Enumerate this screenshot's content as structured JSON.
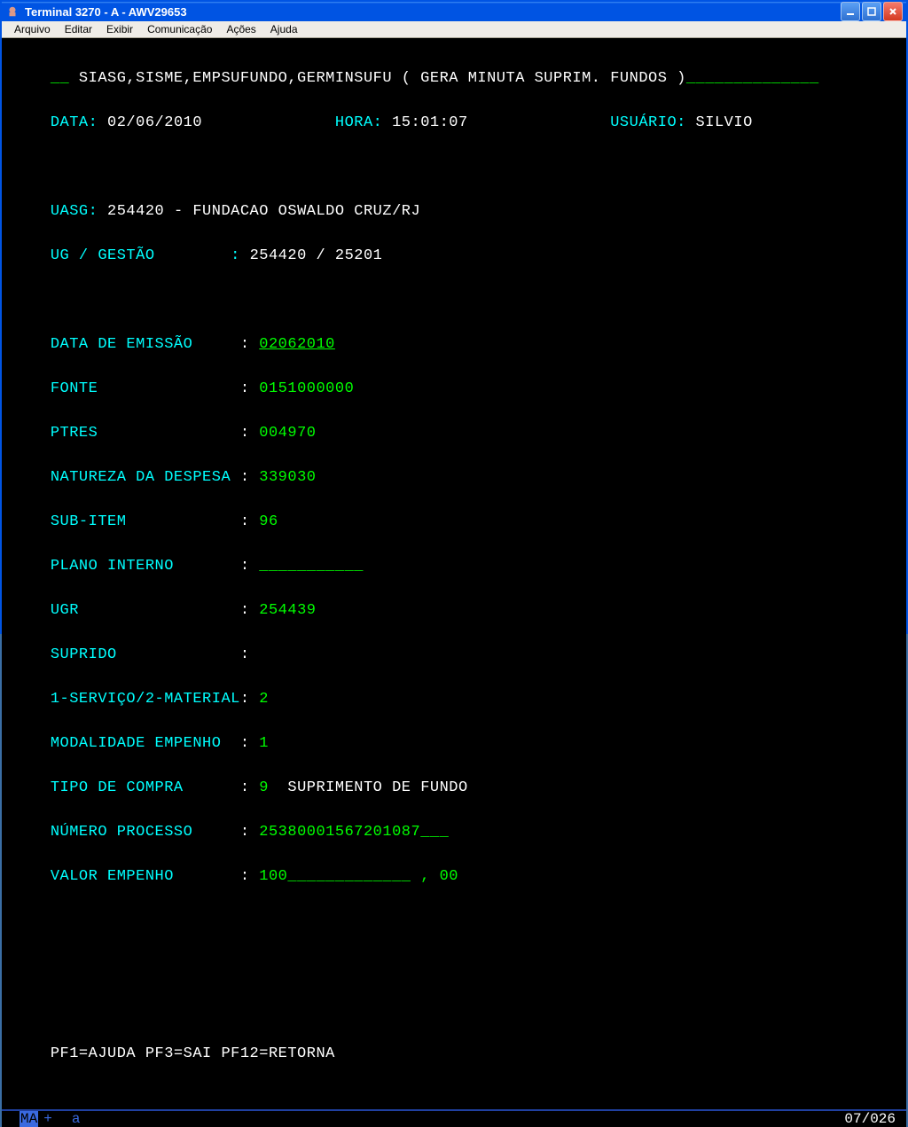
{
  "titlebar": {
    "text": "Terminal 3270 - A - AWV29653"
  },
  "menubar": {
    "arquivo": "Arquivo",
    "editar": "Editar",
    "exibir": "Exibir",
    "comunicacao": "Comunicação",
    "acoes": "Ações",
    "ajuda": "Ajuda"
  },
  "header": {
    "prefix": "__",
    "path": " SIASG,SISME,EMPSUFUNDO,GERMINSUFU ( GERA MINUTA SUPRIM. FUNDOS )",
    "suffix": "______________"
  },
  "line2": {
    "data_label": "DATA:",
    "data_value": " 02/06/2010              ",
    "hora_label": "HORA:",
    "hora_value": " 15:01:07               ",
    "usuario_label": "USUÁRIO:",
    "usuario_value": " SILVIO"
  },
  "uasg": {
    "label": "UASG:",
    "value": " 254420 - FUNDACAO OSWALDO CRUZ/RJ"
  },
  "uggestao": {
    "label": "UG / GESTÃO        : ",
    "value": "254420 / 25201"
  },
  "fields": {
    "data_emissao_label": "DATA DE EMISSÃO     ",
    "data_emissao_value": "02062010",
    "fonte_label": "FONTE               ",
    "fonte_value": "0151000000",
    "ptres_label": "PTRES               ",
    "ptres_value": "004970",
    "natureza_label": "NATUREZA DA DESPESA ",
    "natureza_value": "339030",
    "subitem_label": "SUB-ITEM            ",
    "subitem_value": "96",
    "plano_label": "PLANO INTERNO       ",
    "plano_value": "___________",
    "ugr_label": "UGR                 ",
    "ugr_value": "254439",
    "suprido_label": "SUPRIDO             ",
    "suprido_value": "",
    "servmat_label": "1-SERVIÇO/2-MATERIAL",
    "servmat_value": "2",
    "modalidade_label": "MODALIDADE EMPENHO  ",
    "modalidade_value": "1",
    "tipocompra_label": "TIPO DE COMPRA      ",
    "tipocompra_value": "9",
    "tipocompra_desc": "  SUPRIMENTO DE FUNDO",
    "numproc_label": "NÚMERO PROCESSO     ",
    "numproc_value": "25380001567201087",
    "numproc_suffix": "___",
    "valor_label": "VALOR EMPENHO       ",
    "valor_value": "100",
    "valor_suffix": "_____________ ",
    "valor_dec": ", 00"
  },
  "footer": {
    "pf": "PF1=AJUDA PF3=SAI PF12=RETORNA"
  },
  "status": {
    "ma": "MA",
    "plus": "+",
    "a": "a",
    "pos": "07/026"
  },
  "colon": ": "
}
